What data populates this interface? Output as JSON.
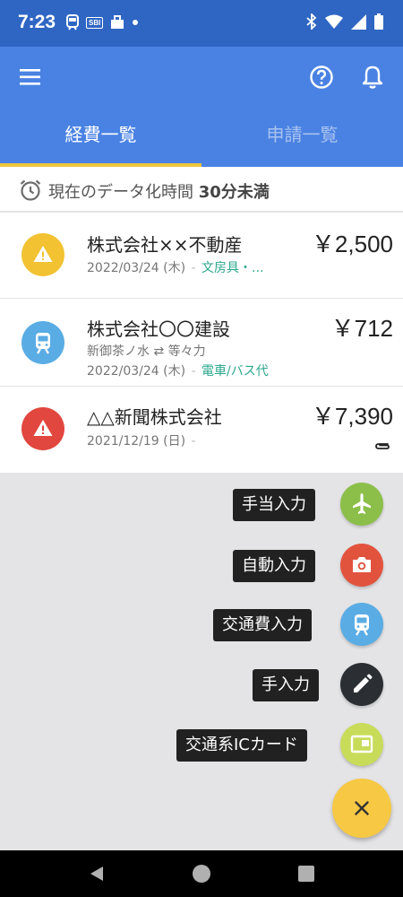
{
  "status_bar": {
    "time": "7:23",
    "left_icons": [
      "train-icon",
      "sbi-icon",
      "briefcase-icon",
      "dot-icon"
    ],
    "sbi_text": "SBI",
    "right_icons": [
      "bluetooth-icon",
      "wifi-icon",
      "signal-icon",
      "battery-icon"
    ]
  },
  "app_bar": {
    "icons": [
      "menu-icon",
      "help-icon",
      "bell-icon"
    ],
    "tabs": [
      {
        "label": "経費一覧",
        "active": true
      },
      {
        "label": "申請一覧",
        "active": false
      }
    ],
    "colors": {
      "background": "#4a82e3",
      "indicator": "#f0c63c"
    }
  },
  "notice": {
    "icon": "alarm-clock-icon",
    "prefix": "現在のデータ化時間",
    "emphasis": "30分未満"
  },
  "expenses": [
    {
      "status_icon": "warning-icon",
      "status_color": "#f2c232",
      "title": "株式会社××不動産",
      "amount": "￥2,500",
      "route": "",
      "date": "2022/03/24 (木)",
      "separator": "-",
      "category": "文房具・..."
    },
    {
      "status_icon": "train-icon",
      "status_color": "#5aace4",
      "title": "株式会社〇〇建設",
      "amount": "￥712",
      "route": "新御茶ノ水 ⇄ 等々力",
      "date": "2022/03/24 (木)",
      "separator": "-",
      "category": "電車/バス代"
    },
    {
      "status_icon": "warning-icon",
      "status_color": "#e1473e",
      "title": "△△新聞株式会社",
      "amount": "￥7,390",
      "route": "",
      "date": "2021/12/19 (日)",
      "separator": "-",
      "category": "",
      "attachment_icon": "paperclip-icon"
    }
  ],
  "fab_menu": [
    {
      "label": "手当入力",
      "icon": "airplane-icon",
      "color": "#8cbf4a"
    },
    {
      "label": "自動入力",
      "icon": "camera-icon",
      "color": "#e2533e"
    },
    {
      "label": "交通費入力",
      "icon": "train-icon",
      "color": "#5aace4"
    },
    {
      "label": "手入力",
      "icon": "pencil-icon",
      "color": "#2b2f33"
    },
    {
      "label": "交通系ICカード",
      "icon": "ic-card-icon",
      "color": "#c8dc5a"
    }
  ],
  "fab_main": {
    "icon": "close-icon",
    "color": "#f7c843"
  },
  "nav_bar": {
    "icons": [
      "back-icon",
      "home-icon",
      "recents-icon"
    ]
  }
}
